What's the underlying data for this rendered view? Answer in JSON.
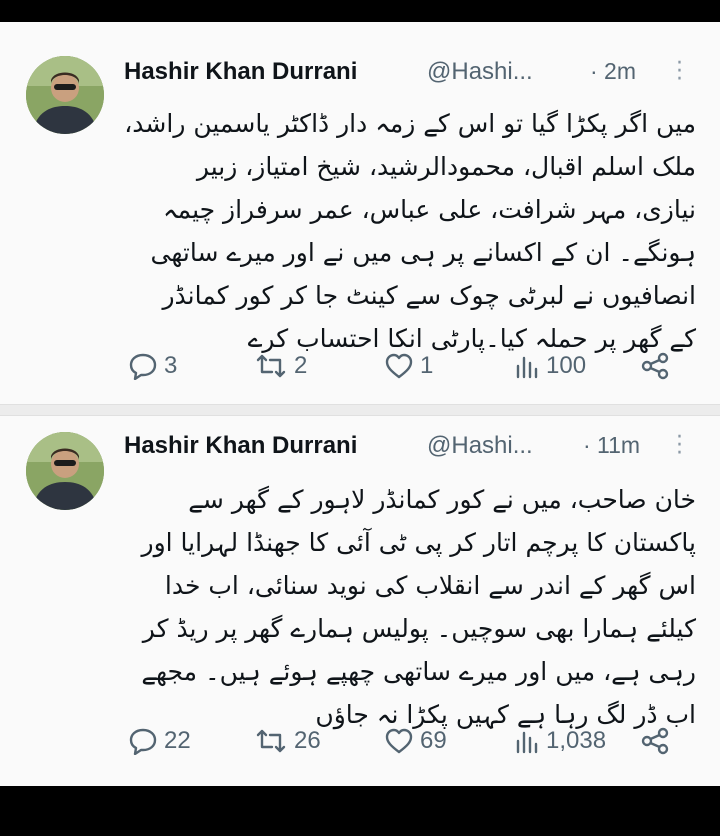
{
  "tweets": [
    {
      "author_name": "Hashir Khan Durrani",
      "handle": "@Hashi...",
      "time": "· 2m",
      "lines": [
        "میں اگر پکڑا گیا تو اس کے زمہ دار ڈاکٹر یاسمین راشد،",
        "ملک اسلم اقبال، محمودالرشید، شیخ امتیاز، زبیر",
        "نیازی، مہر شرافت، علی عباس، عمر سرفراز چیمہ",
        "ہونگے۔ ان کے اکسانے پر ہی میں نے اور میرے ساتھی",
        "انصافیوں نے لبرٹی چوک سے کینٹ جا کر کور کمانڈر",
        "کے گھر پر حملہ کیا۔پارٹی انکا احتساب کرے"
      ],
      "replies": "3",
      "retweets": "2",
      "likes": "1",
      "views": "100"
    },
    {
      "author_name": "Hashir Khan Durrani",
      "handle": "@Hashi...",
      "time": "· 11m",
      "lines": [
        "خان صاحب، میں نے کور کمانڈر لاہور کے گھر سے",
        "پاکستان کا پرچم اتار کر پی ٹی آئی کا جھنڈا لہرایا اور",
        "اس گھر کے اندر سے انقلاب کی نوید سنائی، اب خدا",
        "کیلئے ہمارا بھی سوچیں۔ پولیس ہمارے گھر پر ریڈ کر",
        "رہی ہے، میں اور میرے ساتھی چھپے ہوئے ہیں۔ مجھے",
        "اب ڈر لگ رہا ہے کہیں پکڑا نہ جاؤں"
      ],
      "replies": "22",
      "retweets": "26",
      "likes": "69",
      "views": "1,038"
    }
  ],
  "icons": {
    "reply": "reply-icon",
    "retweet": "retweet-icon",
    "like": "heart-icon",
    "views": "views-icon",
    "share": "share-icon",
    "more": "more-vertical-icon"
  },
  "colors": {
    "text": "#0f1419",
    "muted": "#536471",
    "background": "#fafafa"
  }
}
